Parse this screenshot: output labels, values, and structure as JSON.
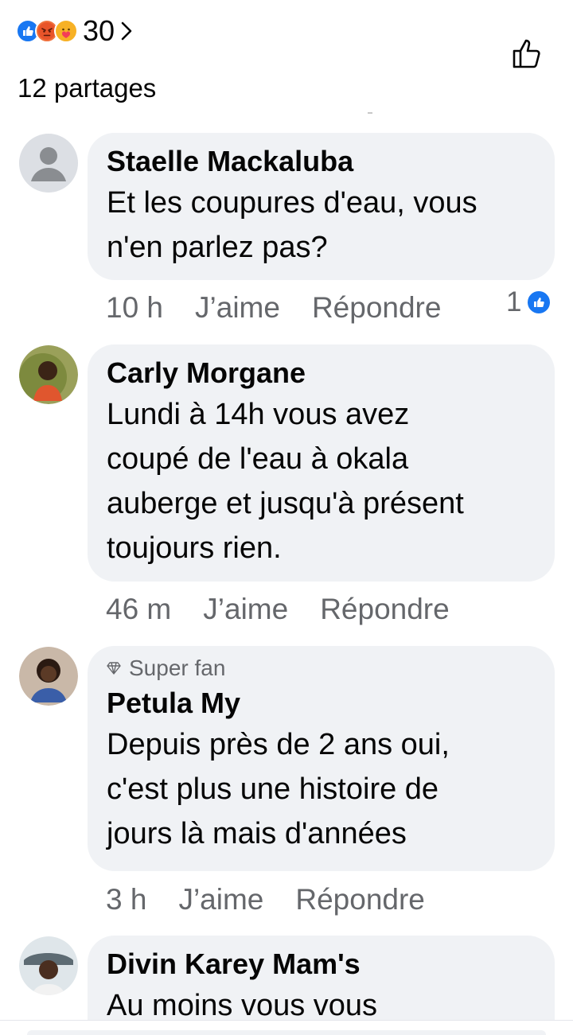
{
  "post": {
    "reaction_count": "30",
    "reaction_types": [
      "like-icon",
      "angry-icon",
      "care-icon"
    ],
    "shares_label": "12 partages"
  },
  "colors": {
    "accent": "#1877f2",
    "bubble": "#f0f2f5",
    "secondary_text": "#65676b"
  },
  "comments": [
    {
      "author": "Staelle Mackaluba",
      "lines": [
        "Et les coupures d'eau, vous",
        "n'en parlez pas?"
      ],
      "time": "10 h",
      "like_label": "J’aime",
      "reply_label": "Répondre",
      "reaction_count": "1"
    },
    {
      "author": "Carly Morgane",
      "lines": [
        "Lundi à 14h vous avez",
        "coupé de l'eau à okala",
        "auberge et jusqu'à présent",
        "toujours rien."
      ],
      "time": "46 m",
      "like_label": "J’aime",
      "reply_label": "Répondre"
    },
    {
      "badge": "Super fan",
      "author": "Petula My",
      "lines": [
        "Depuis près de 2 ans oui,",
        "c'est plus une histoire de",
        "jours là mais d'années"
      ],
      "time": "3 h",
      "like_label": "J’aime",
      "reply_label": "Répondre"
    },
    {
      "author": "Divin Karey Mam's",
      "lines": [
        "Au moins vous vous"
      ]
    }
  ]
}
